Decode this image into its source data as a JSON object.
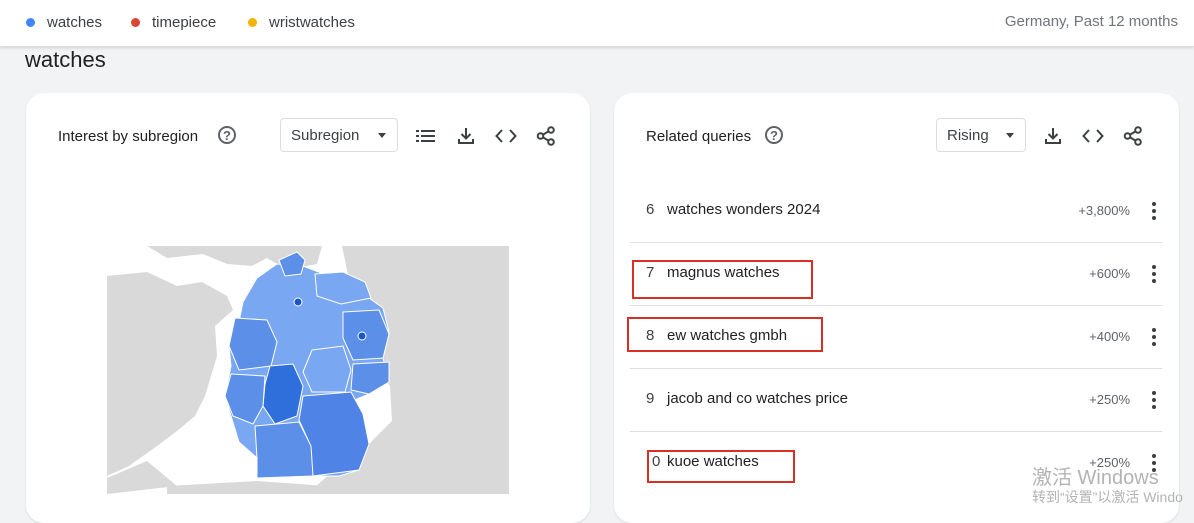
{
  "header": {
    "legend": [
      {
        "label": "watches",
        "color": "#4285f4"
      },
      {
        "label": "timepiece",
        "color": "#db4437"
      },
      {
        "label": "wristwatches",
        "color": "#f4b400"
      }
    ],
    "meta": "Germany, Past 12 months"
  },
  "section_title": "watches",
  "subregion_card": {
    "title": "Interest by subregion",
    "help_icon": "help-circle-icon",
    "select_value": "Subregion",
    "tools": [
      "list-icon",
      "download-icon",
      "embed-code-icon",
      "share-icon"
    ]
  },
  "queries_card": {
    "title": "Related queries",
    "help_icon": "help-circle-icon",
    "select_value": "Rising",
    "tools": [
      "download-icon",
      "embed-code-icon",
      "share-icon"
    ],
    "rows": [
      {
        "rank": "6",
        "query": "watches wonders 2024",
        "value": "+3,800%"
      },
      {
        "rank": "7",
        "query": "magnus watches",
        "value": "+600%"
      },
      {
        "rank": "8",
        "query": "ew watches gmbh",
        "value": "+400%"
      },
      {
        "rank": "9",
        "query": "jacob and co watches price",
        "value": "+250%"
      },
      {
        "rank": "0",
        "query": "kuoe watches",
        "value": "+250%"
      }
    ]
  },
  "watermark": {
    "line1": "激活 Windows",
    "line2": "转到“设置”以激活 Windo"
  },
  "colors": {
    "map_land": "#d9d9d9",
    "map_region_light": "#7aa7f1",
    "map_region_mid": "#5b8fe8",
    "map_region_dark": "#2f6fdb",
    "annotation": "#d93025"
  }
}
